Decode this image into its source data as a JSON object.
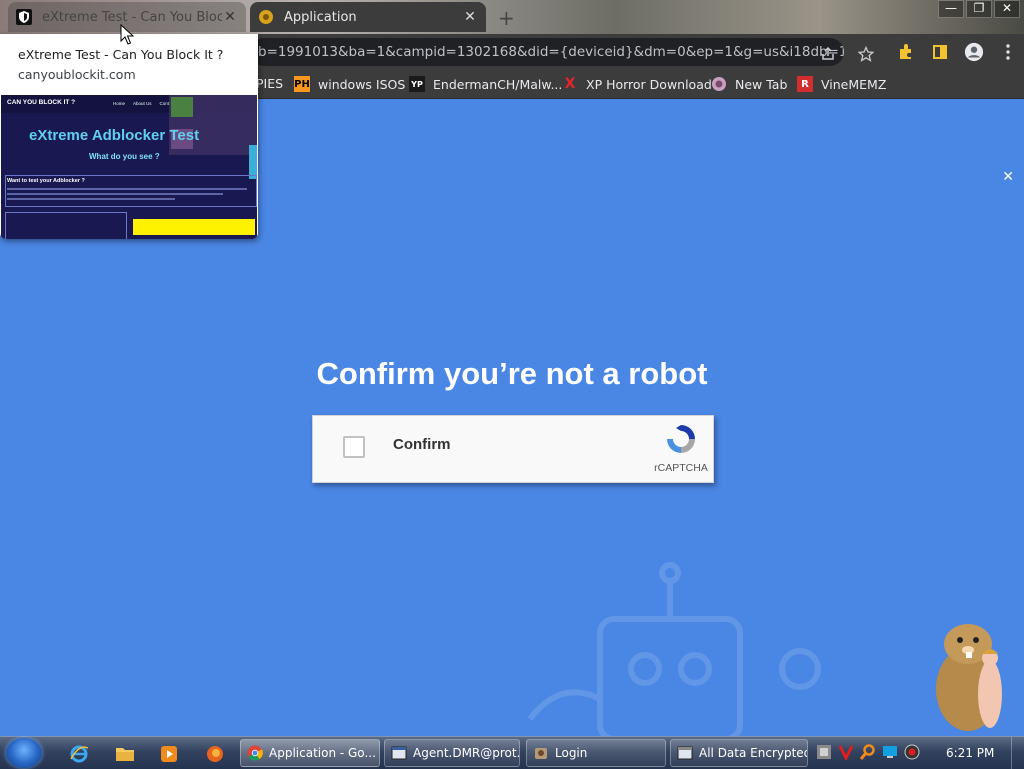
{
  "tabs": [
    {
      "label": "eXtreme Test - Can You Block It ?",
      "close": "✕"
    },
    {
      "label": "Application",
      "close": "✕"
    }
  ],
  "new_tab_symbol": "+",
  "window_controls": [
    "—",
    "❐",
    "✕"
  ],
  "address_bar": {
    "url": "b=1991013&ba=1&campid=1302168&did={deviceid}&dm=0&ep=1&g=us&i18db=1&..."
  },
  "toolbar_icons": [
    "share-icon",
    "star-icon",
    "extensions-icon",
    "sidepanel-icon",
    "profile-icon",
    "menu-icon"
  ],
  "bookmarks": [
    {
      "label": "PIES",
      "icon": "bookmark-folder-icon"
    },
    {
      "label": "windows ISOS",
      "icon": "ph-icon",
      "icon_text": "PH"
    },
    {
      "label": "EndermanCH/Malw...",
      "icon": "yp-icon",
      "icon_text": "YP"
    },
    {
      "label": "XP Horror Download",
      "icon": "x-icon",
      "icon_text": "X"
    },
    {
      "label": "New Tab",
      "icon": "globe-icon"
    },
    {
      "label": "VineMEMZ",
      "icon": "r-icon",
      "icon_text": "R"
    }
  ],
  "page": {
    "close_symbol": "✕",
    "headline": "Confirm you’re not a robot",
    "captcha": {
      "label": "Confirm",
      "brand": "rCAPTCHA"
    }
  },
  "hover_card": {
    "title": "eXtreme Test - Can You Block It ?",
    "domain": "canyoublockit.com",
    "preview": {
      "logo": "CAN YOU BLOCK IT ?",
      "nav": [
        "Home",
        "About Us",
        "Conta"
      ],
      "headline": "eXtreme Adblocker Test",
      "subheadline": "What do you see ?",
      "box_heading": "Want to test your Adblocker ?"
    }
  },
  "taskbar": {
    "quick_launch": [
      "ie-icon",
      "folder-icon",
      "media-player-icon",
      "firefox-icon"
    ],
    "buttons": [
      {
        "label": "Application - Go...",
        "icon": "chrome-icon",
        "active": true
      },
      {
        "label": "Agent.DMR@prot...",
        "icon": "app-window-icon",
        "active": false
      },
      {
        "label": "Login",
        "icon": "login-app-icon",
        "active": false
      },
      {
        "label": "All Data Encrypted",
        "icon": "encrypted-window-icon",
        "active": false
      }
    ],
    "tray_icons": [
      "tray-app-icon",
      "tray-v-icon",
      "tray-search-icon",
      "tray-monitor-icon",
      "tray-record-icon"
    ],
    "clock": "6:21 PM"
  },
  "colors": {
    "page_bg": "#4a86e4",
    "chrome_dark": "#3c3c3c",
    "omnibox": "#202124"
  }
}
